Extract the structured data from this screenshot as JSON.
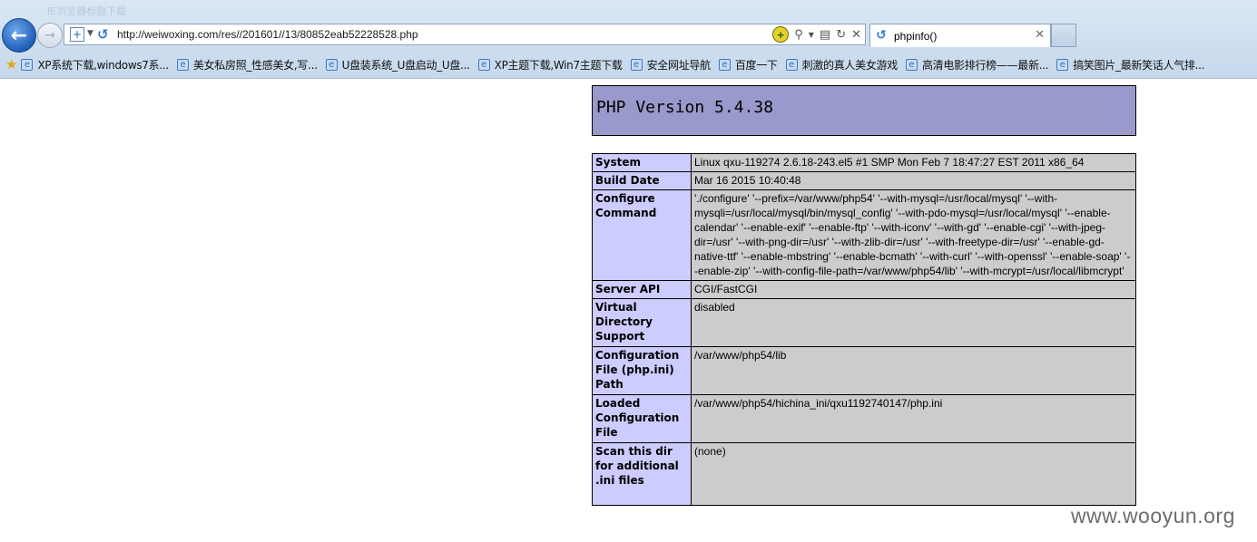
{
  "browser": {
    "window_title": "IE浏览器标题下载",
    "address_url": "http://weiwoxing.com/res//201601//13/80852eab52228528.php",
    "tab_title": "phpinfo()",
    "favorites": [
      "XP系统下载,windows7系...",
      "美女私房照_性感美女,写...",
      "U盘装系统_U盘启动_U盘...",
      "XP主题下载,Win7主题下载",
      "安全网址导航",
      "百度一下",
      "刺激的真人美女游戏",
      "高清电影排行榜——最新...",
      "搞笑图片_最新笑话人气排..."
    ],
    "icons": {
      "back": "back-arrow-icon",
      "forward": "forward-arrow-icon",
      "search": "search-icon",
      "refresh": "refresh-icon",
      "stop": "stop-icon",
      "close_tab": "close-icon"
    }
  },
  "phpinfo": {
    "version": "PHP Version 5.4.38",
    "rows": [
      {
        "key": "System",
        "value": "Linux qxu-119274 2.6.18-243.el5 #1 SMP Mon Feb 7 18:47:27 EST 2011 x86_64"
      },
      {
        "key": "Build Date",
        "value": "Mar 16 2015 10:40:48"
      },
      {
        "key": "Configure Command",
        "value": "'./configure' '--prefix=/var/www/php54' '--with-mysql=/usr/local/mysql' '--with-mysqli=/usr/local/mysql/bin/mysql_config' '--with-pdo-mysql=/usr/local/mysql' '--enable-calendar' '--enable-exif' '--enable-ftp' '--with-iconv' '--with-gd' '--enable-cgi' '--with-jpeg-dir=/usr' '--with-png-dir=/usr' '--with-zlib-dir=/usr' '--with-freetype-dir=/usr' '--enable-gd-native-ttf' '--enable-mbstring' '--enable-bcmath' '--with-curl' '--with-openssl' '--enable-soap' '--enable-zip' '--with-config-file-path=/var/www/php54/lib' '--with-mcrypt=/usr/local/libmcrypt'"
      },
      {
        "key": "Server API",
        "value": "CGI/FastCGI"
      },
      {
        "key": "Virtual Directory Support",
        "value": "disabled"
      },
      {
        "key": "Configuration File (php.ini) Path",
        "value": "/var/www/php54/lib"
      },
      {
        "key": "Loaded Configuration File",
        "value": "/var/www/php54/hichina_ini/qxu1192740147/php.ini"
      },
      {
        "key": "Scan this dir for additional .ini files",
        "value": "(none)"
      }
    ]
  },
  "watermark": "www.wooyun.org",
  "colors": {
    "php_header": "#9999cc",
    "key_cell": "#ccccff",
    "value_cell": "#cccccc"
  }
}
